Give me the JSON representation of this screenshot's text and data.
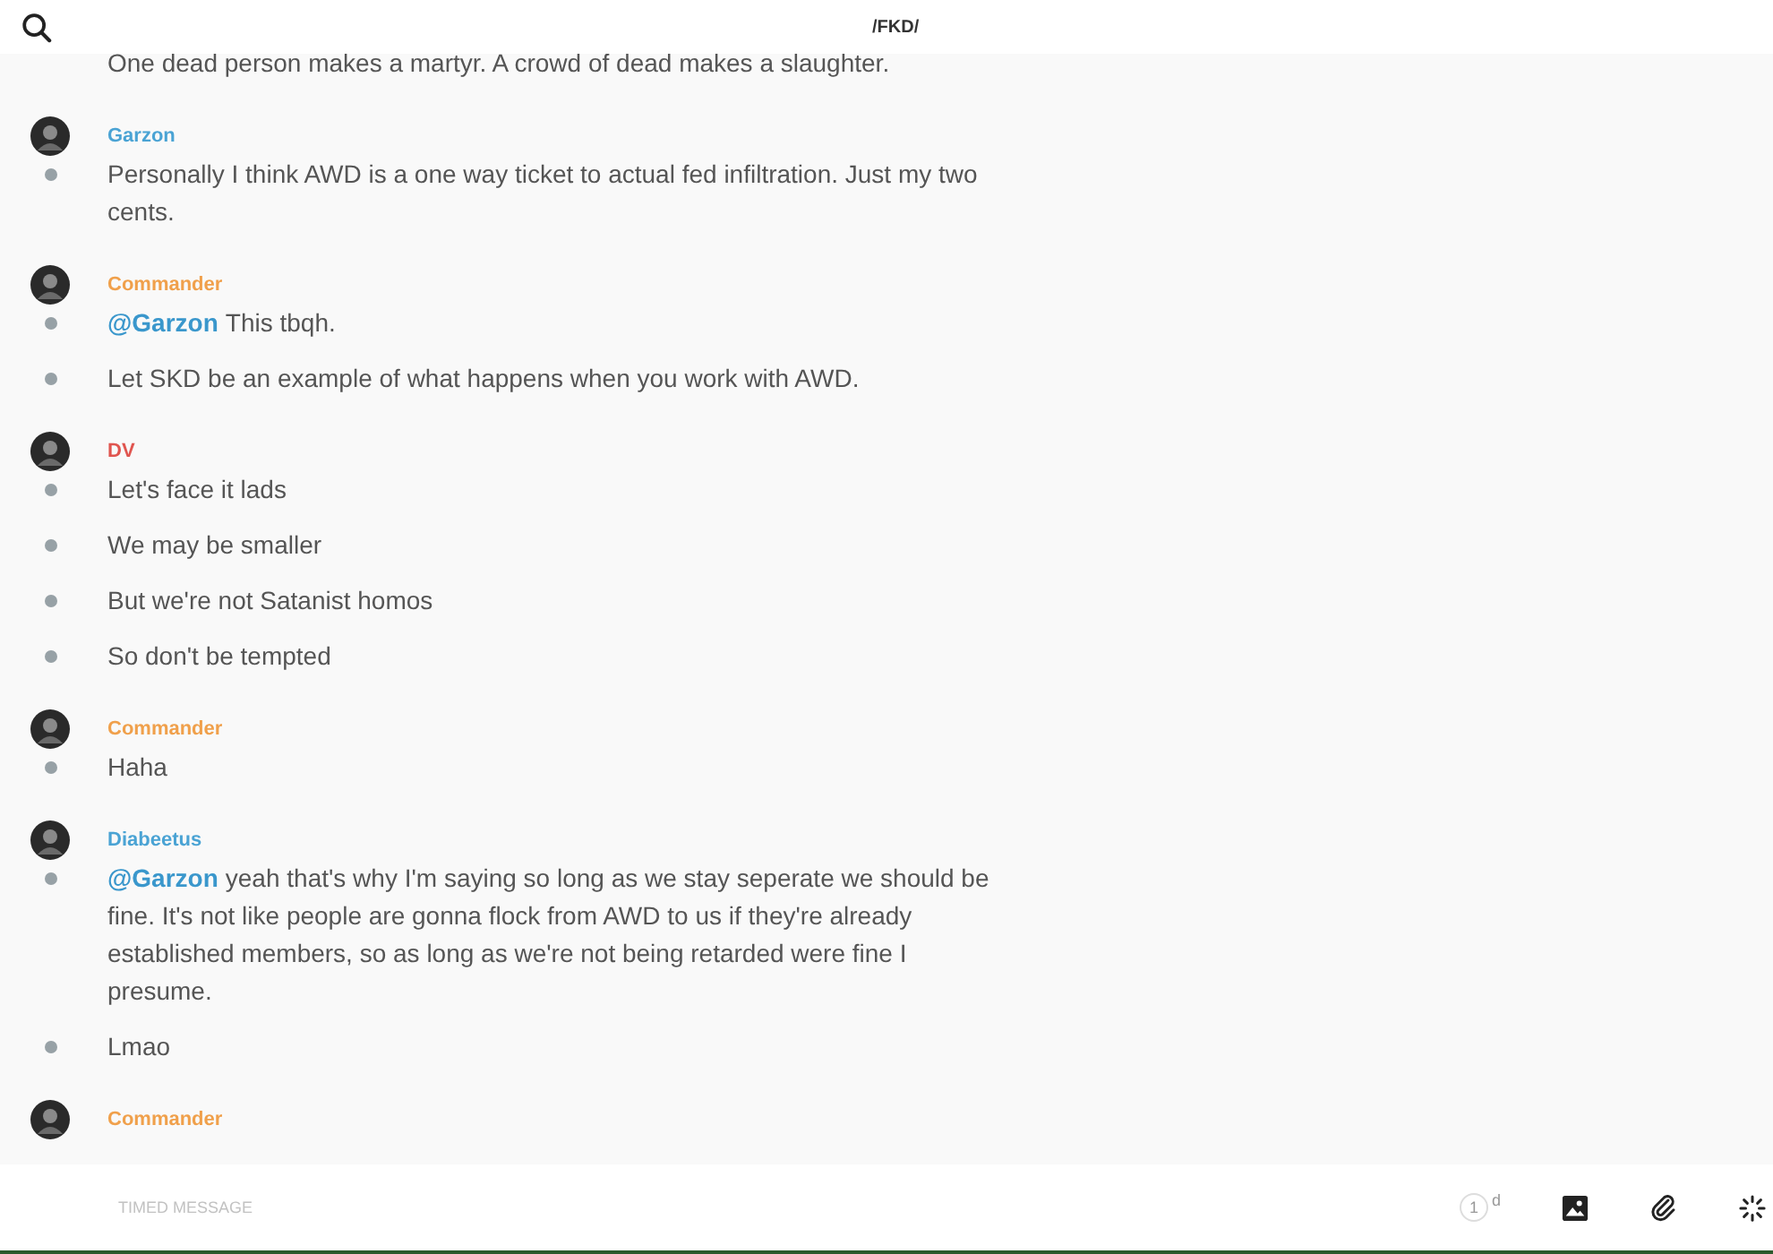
{
  "header": {
    "title": "/FKD/"
  },
  "groups": [
    {
      "messages": [
        {
          "text": "One dead person makes a martyr. A crowd of dead makes a slaughter."
        }
      ]
    },
    {
      "author": "Garzon",
      "color": "#4aa3d4",
      "messages": [
        {
          "text": "Personally I think AWD is a one way ticket to actual fed infiltration. Just my two cents."
        }
      ]
    },
    {
      "author": "Commander",
      "color": "#f0a04b",
      "messages": [
        {
          "mention": "@Garzon",
          "text": "This tbqh."
        },
        {
          "text": "Let SKD be an example of what happens when you work with AWD."
        }
      ]
    },
    {
      "author": "DV",
      "color": "#e0554f",
      "messages": [
        {
          "text": "Let's face it lads"
        },
        {
          "text": "We may be smaller"
        },
        {
          "text": "But we're not Satanist homos"
        },
        {
          "text": "So don't be tempted"
        }
      ]
    },
    {
      "author": "Commander",
      "color": "#f0a04b",
      "messages": [
        {
          "text": "Haha"
        }
      ]
    },
    {
      "author": "Diabeetus",
      "color": "#4aa3d4",
      "messages": [
        {
          "mention": "@Garzon",
          "text": "yeah that's why I'm saying so long as we stay seperate we should be fine. It's not like people are gonna flock from AWD to us if they're already established members, so as long as we're not being retarded were fine I presume."
        },
        {
          "text": "Lmao"
        }
      ]
    },
    {
      "author": "Commander",
      "color": "#f0a04b"
    }
  ],
  "composer": {
    "placeholder": "TIMED MESSAGE",
    "timer": "1",
    "timer_unit": "d"
  }
}
